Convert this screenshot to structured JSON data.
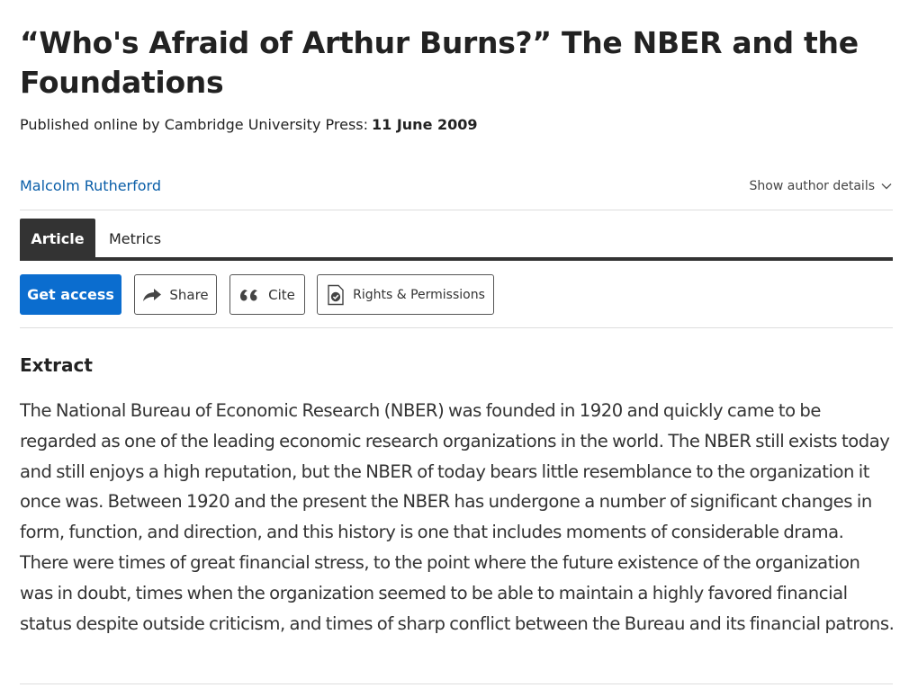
{
  "article": {
    "title": "“Who's Afraid of Arthur Burns?” The NBER and the Foundations",
    "published_label": "Published online by Cambridge University Press:",
    "published_date": "11 June 2009",
    "author": "Malcolm Rutherford",
    "show_author_details": "Show author details"
  },
  "tabs": [
    {
      "label": "Article",
      "active": true
    },
    {
      "label": "Metrics",
      "active": false
    }
  ],
  "actions": {
    "get_access": "Get access",
    "share": "Share",
    "cite": "Cite",
    "rights": "Rights & Permissions"
  },
  "extract": {
    "heading": "Extract",
    "body": "The National Bureau of Economic Research (NBER) was founded in 1920 and quickly came to be regarded as one of the leading economic research organizations in the world. The NBER still exists today and still enjoys a high reputation, but the NBER of today bears little resemblance to the organization it once was. Between 1920 and the present the NBER has undergone a number of significant changes in form, function, and direction, and this history is one that includes moments of considerable drama. There were times of great financial stress, to the point where the future existence of the organization was in doubt, times when the organization seemed to be able to maintain a highly favored financial status despite outside criticism, and times of sharp conflict between the Bureau and its financial patrons."
  },
  "colors": {
    "link": "#0a5ea8",
    "primary_button": "#0b6dcf",
    "active_tab": "#333333"
  },
  "icons": {
    "share": "share-arrow-icon",
    "cite": "quote-icon",
    "rights": "document-check-icon",
    "author_details": "chevron-down-icon"
  }
}
